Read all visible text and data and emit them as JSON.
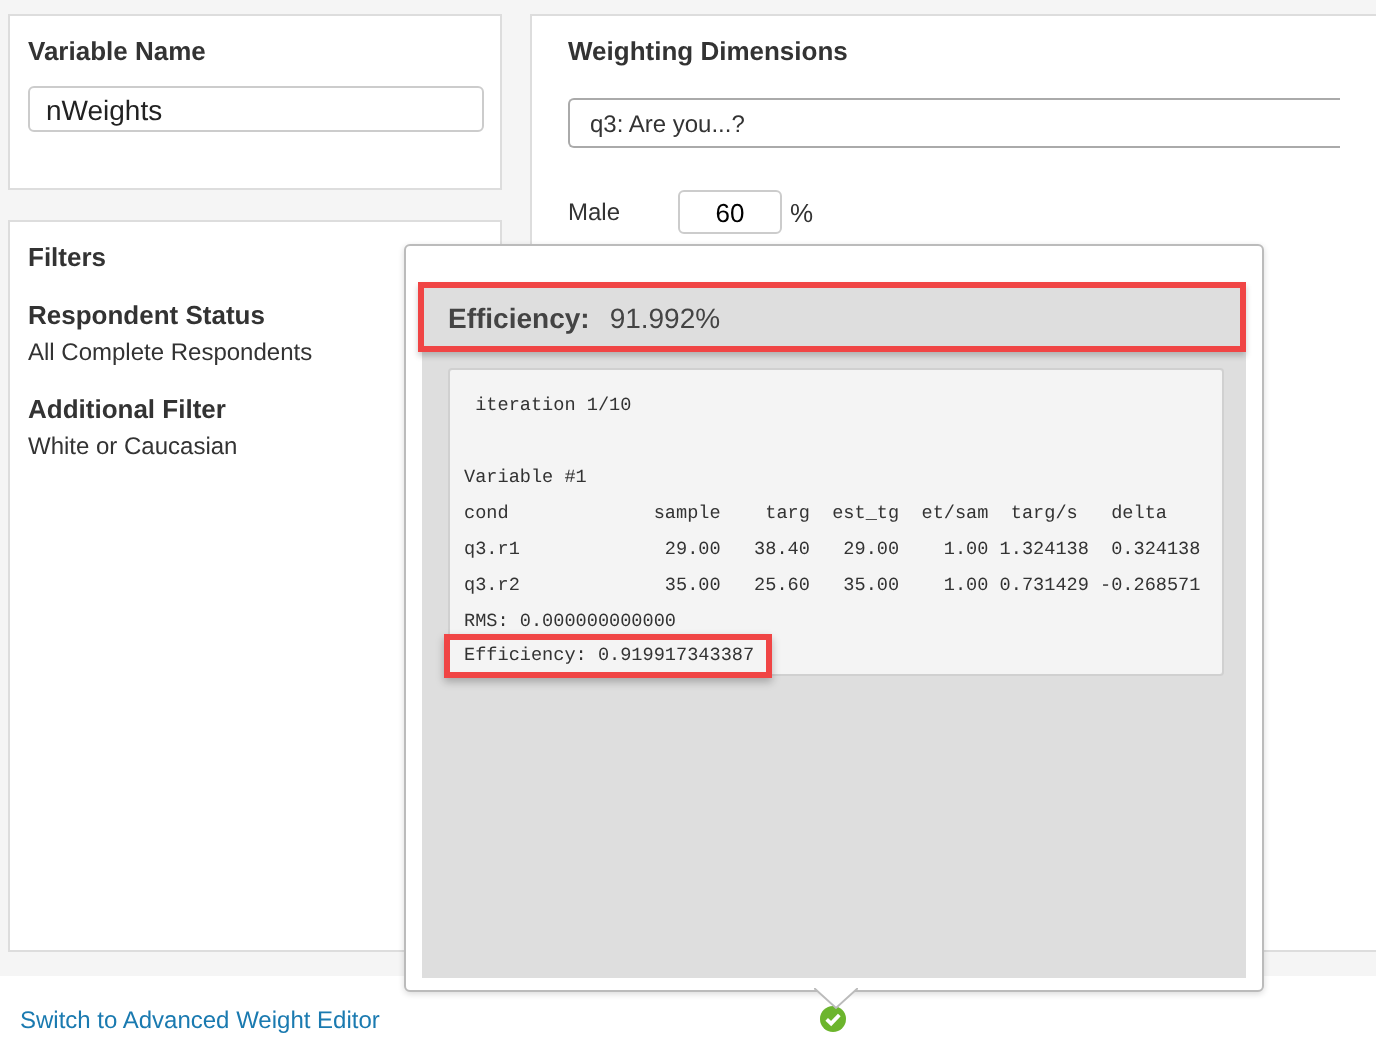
{
  "variable_panel": {
    "title": "Variable Name",
    "value": "nWeights"
  },
  "filters_panel": {
    "title": "Filters",
    "sections": [
      {
        "heading": "Respondent Status",
        "value": "All Complete Respondents"
      },
      {
        "heading": "Additional Filter",
        "value": "White or Caucasian"
      }
    ]
  },
  "dimensions_panel": {
    "title": "Weighting Dimensions",
    "question": "q3: Are you...?",
    "targets": [
      {
        "label": "Male",
        "value": "60",
        "unit": "%"
      }
    ]
  },
  "popover": {
    "efficiency_label": "Efficiency:",
    "efficiency_value": "91.992%",
    "highlighted": true,
    "iteration": " iteration 1/10",
    "output_lines": [
      "Variable #1",
      "cond             sample    targ  est_tg  et/sam  targ/s   delta",
      "q3.r1             29.00   38.40   29.00    1.00 1.324138  0.324138",
      "q3.r2             35.00   25.60   35.00    1.00 0.731429 -0.268571",
      "RMS: 0.000000000000"
    ],
    "result_line": {
      "text": "Efficiency: 0.919917343387",
      "highlighted": true
    }
  },
  "footer": {
    "link": "Switch to Advanced Weight Editor",
    "status_ok": true
  }
}
